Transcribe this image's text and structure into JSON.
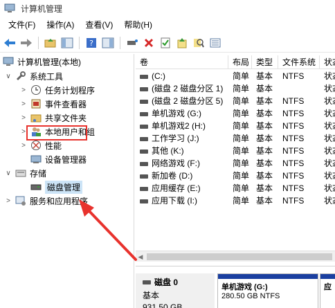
{
  "window": {
    "title": "计算机管理"
  },
  "menu": [
    "文件(F)",
    "操作(A)",
    "查看(V)",
    "帮助(H)"
  ],
  "tree": {
    "root": "计算机管理(本地)",
    "system_tools": "系统工具",
    "items": [
      "任务计划程序",
      "事件查看器",
      "共享文件夹",
      "本地用户和组",
      "性能",
      "设备管理器"
    ],
    "storage": "存储",
    "disk_mgmt": "磁盘管理",
    "services": "服务和应用程序"
  },
  "columns": [
    "卷",
    "布局",
    "类型",
    "文件系统",
    "状态"
  ],
  "volumes": [
    {
      "name": "(C:)",
      "layout": "简单",
      "type": "基本",
      "fs": "NTFS",
      "status": "状态"
    },
    {
      "name": "(磁盘 2 磁盘分区 1)",
      "layout": "简单",
      "type": "基本",
      "fs": "",
      "status": "状态"
    },
    {
      "name": "(磁盘 2 磁盘分区 5)",
      "layout": "简单",
      "type": "基本",
      "fs": "NTFS",
      "status": "状态"
    },
    {
      "name": "单机游戏 (G:)",
      "layout": "简单",
      "type": "基本",
      "fs": "NTFS",
      "status": "状态"
    },
    {
      "name": "单机游戏2 (H:)",
      "layout": "简单",
      "type": "基本",
      "fs": "NTFS",
      "status": "状态"
    },
    {
      "name": "工作学习 (J:)",
      "layout": "简单",
      "type": "基本",
      "fs": "NTFS",
      "status": "状态"
    },
    {
      "name": "其他 (K:)",
      "layout": "简单",
      "type": "基本",
      "fs": "NTFS",
      "status": "状态"
    },
    {
      "name": "网络游戏 (F:)",
      "layout": "简单",
      "type": "基本",
      "fs": "NTFS",
      "status": "状态"
    },
    {
      "name": "新加卷 (D:)",
      "layout": "简单",
      "type": "基本",
      "fs": "NTFS",
      "status": "状态"
    },
    {
      "name": "应用缓存 (E:)",
      "layout": "简单",
      "type": "基本",
      "fs": "NTFS",
      "status": "状态"
    },
    {
      "name": "应用下载 (I:)",
      "layout": "简单",
      "type": "基本",
      "fs": "NTFS",
      "status": "状态"
    }
  ],
  "disk": {
    "name": "磁盘 0",
    "kind": "基本",
    "size": "931.50 GB",
    "partition1": {
      "label": "单机游戏  (G:)",
      "detail": "280.50 GB NTFS"
    },
    "partition2": {
      "label": "应"
    }
  },
  "colors": {
    "partition_bar": "#1a3fa0",
    "highlight": "#e8322d",
    "selection": "#cce4f7"
  }
}
